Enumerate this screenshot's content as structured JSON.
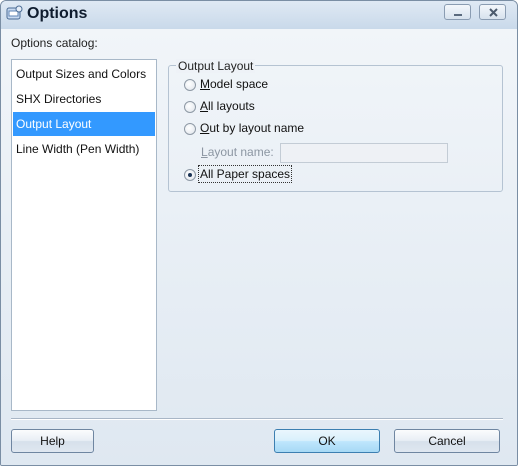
{
  "window": {
    "title": "Options",
    "icons": {
      "app": "options-app-icon",
      "minimize": "minimize-icon",
      "close": "close-icon"
    }
  },
  "catalog": {
    "label": "Options catalog:",
    "items": [
      {
        "label": "Output Sizes and Colors",
        "selected": false
      },
      {
        "label": "SHX Directories",
        "selected": false
      },
      {
        "label": "Output Layout",
        "selected": true
      },
      {
        "label": "Line Width (Pen Width)",
        "selected": false
      }
    ]
  },
  "output_layout": {
    "legend": "Output Layout",
    "options": [
      {
        "mnemonic": "M",
        "rest": "odel space",
        "checked": false
      },
      {
        "mnemonic": "A",
        "rest": "ll layouts",
        "checked": false
      },
      {
        "mnemonic": "O",
        "rest": "ut by layout name",
        "checked": false
      },
      {
        "mnemonic": "",
        "rest": "All Paper spaces",
        "checked": true
      }
    ],
    "layout_name": {
      "label_mnemonic": "L",
      "label_rest": "ayout name:",
      "value": "",
      "enabled": false
    }
  },
  "buttons": {
    "help": "Help",
    "ok": "OK",
    "cancel": "Cancel"
  },
  "colors": {
    "selection": "#3399ff",
    "default_button": "#bee6fd"
  }
}
